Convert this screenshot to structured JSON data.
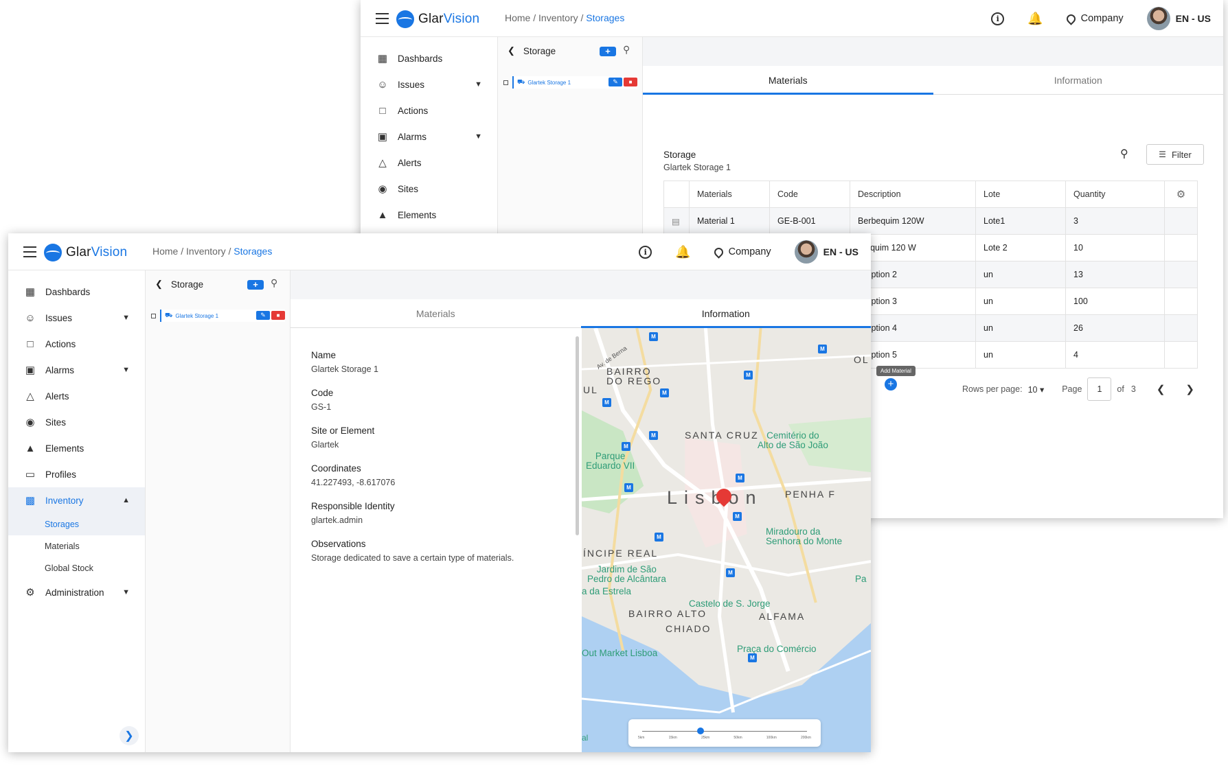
{
  "app": {
    "logo_part1": "Glar",
    "logo_part2": "Vision",
    "breadcrumb": {
      "home": "Home /",
      "inventory": "Inventory /",
      "current": "Storages"
    },
    "company": "Company",
    "language": "EN - US",
    "accent_color": "#1976e3"
  },
  "sidebar": {
    "items": [
      {
        "label": "Dashbards",
        "icon": "dashboard-icon"
      },
      {
        "label": "Issues",
        "icon": "issues-icon"
      },
      {
        "label": "Actions",
        "icon": "actions-icon"
      },
      {
        "label": "Alarms",
        "icon": "alarms-icon"
      },
      {
        "label": "Alerts",
        "icon": "alert-triangle-icon"
      },
      {
        "label": "Sites",
        "icon": "map-pin-icon"
      },
      {
        "label": "Elements",
        "icon": "elements-icon"
      },
      {
        "label": "Profiles",
        "icon": "profiles-icon"
      },
      {
        "label": "Inventory",
        "icon": "inventory-icon"
      },
      {
        "label": "Administration",
        "icon": "gear-icon"
      }
    ],
    "inventory_sub": [
      "Storages",
      "Materials",
      "Global Stock"
    ]
  },
  "tree": {
    "title": "Storage",
    "node": "Glartek Storage 1"
  },
  "tabs": {
    "materials": "Materials",
    "information": "Information"
  },
  "materials_view": {
    "storage_label": "Storage",
    "storage_value": "Glartek Storage 1",
    "filter_label": "Filter",
    "columns": [
      "Materials",
      "Code",
      "Description",
      "Lote",
      "Quantity"
    ],
    "rows": [
      [
        "Material 1",
        "GE-B-001",
        "Berbequim 120W",
        "Lote1",
        "3"
      ],
      [
        "",
        "",
        "rbequim 120 W",
        "Lote 2",
        "10"
      ],
      [
        "",
        "",
        "scription 2",
        "un",
        "13"
      ],
      [
        "",
        "",
        "scription 3",
        "un",
        "100"
      ],
      [
        "",
        "",
        "scription 4",
        "un",
        "26"
      ],
      [
        "",
        "",
        "scription 5",
        "un",
        "4"
      ]
    ],
    "tooltip": "Add Material",
    "rows_per_page_label": "Rows per page:",
    "rows_per_page": "10",
    "page_label": "Page",
    "page": "1",
    "of_label": "of",
    "total_pages": "3"
  },
  "info_view": {
    "fields": [
      {
        "label": "Name",
        "value": "Glartek Storage 1"
      },
      {
        "label": "Code",
        "value": "GS-1"
      },
      {
        "label": "Site or Element",
        "value": "Glartek"
      },
      {
        "label": "Coordinates",
        "value": "41.227493, -8.617076"
      },
      {
        "label": "Responsible Identity",
        "value": "glartek.admin"
      },
      {
        "label": "Observations",
        "value": "Storage dedicated to save a certain type of materials."
      }
    ]
  },
  "map": {
    "labels": {
      "bairro_rego": "BAIRRO\nDO REGO",
      "santa_cruz": "SANTA CRUZ",
      "cemiterio": "Cemitério do\nAlto de São João",
      "parque": "Parque\nEduardo VII",
      "lisbon": "Lisbon",
      "penha": "PENHA F",
      "miradouro": "Miradouro da\nSenhora do Monte",
      "principe": "ÍNCIPE REAL",
      "jardim": "Jardim de São\nPedro de Alcântara",
      "estrela": "a da Estrela",
      "castelo": "Castelo de S. Jorge",
      "bairro_alto": "BAIRRO ALTO",
      "alfama": "ALFAMA",
      "chiado": "CHIADO",
      "market": "Out Market Lisboa",
      "praca": "Praça do Comércio",
      "av_berna": "Av. de Berna",
      "ul": "UL",
      "ol": "OL",
      "pa": "Pa",
      "al": "al"
    },
    "scale": [
      "5km",
      "15km",
      "25km",
      "50km",
      "100km",
      "200km"
    ]
  }
}
